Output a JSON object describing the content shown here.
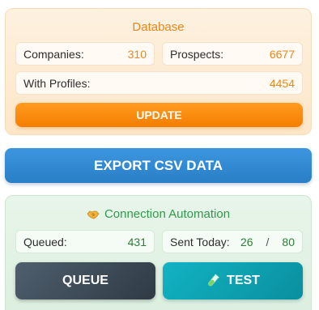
{
  "database": {
    "title": "Database",
    "companies_label": "Companies:",
    "companies_value": "310",
    "prospects_label": "Prospects:",
    "prospects_value": "6677",
    "with_profiles_label": "With Profiles:",
    "with_profiles_value": "4454",
    "update_label": "UPDATE"
  },
  "export": {
    "label": "EXPORT CSV DATA"
  },
  "connection": {
    "title": "Connection Automation",
    "title_icon": "handshake-icon",
    "queued_label": "Queued:",
    "queued_value": "431",
    "sent_today_label": "Sent Today:",
    "sent_today_value": "26",
    "sent_separator": "/",
    "sent_limit": "80",
    "queue_label": "QUEUE",
    "test_label": "TEST",
    "test_icon": "test-tube-icon"
  },
  "colors": {
    "database_accent": "#e8871e",
    "export_blue": "#2a7fc6",
    "connection_green": "#2f9a4a",
    "queue_dark": "#37434f",
    "test_teal": "#0e9fae"
  }
}
